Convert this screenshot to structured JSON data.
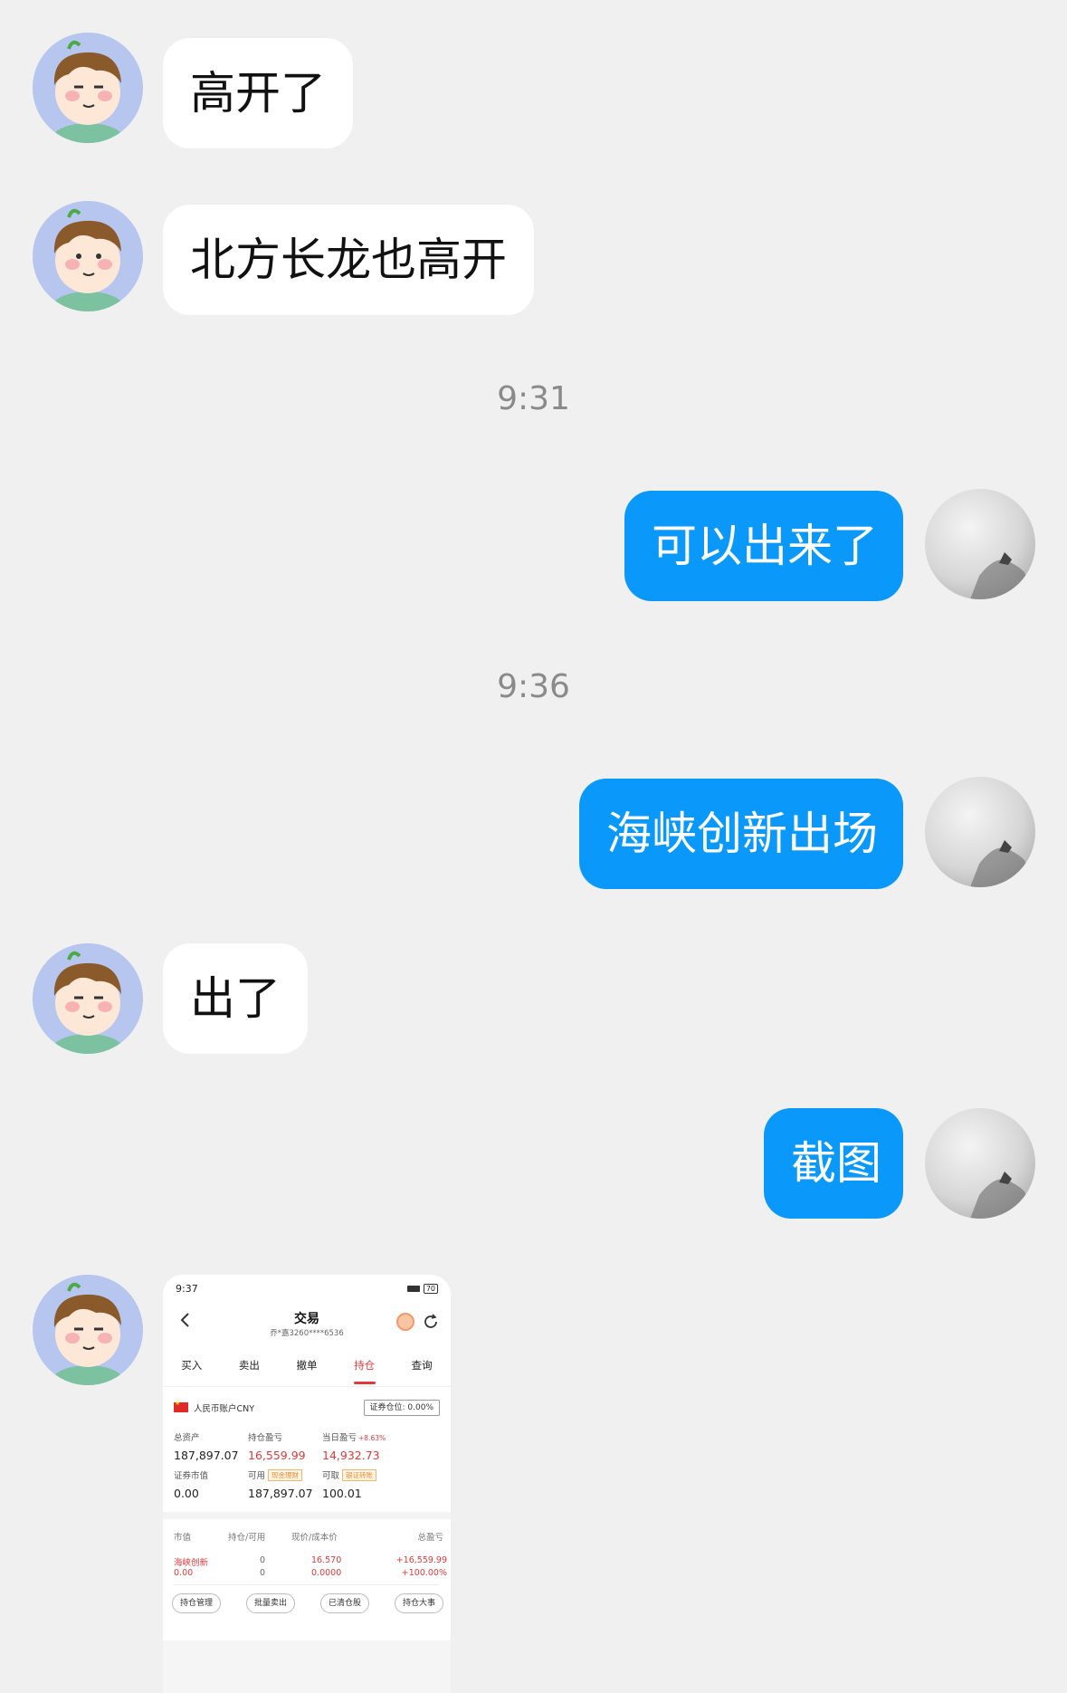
{
  "messages": [
    {
      "text": "高开了"
    },
    {
      "text": "北方长龙也高开"
    },
    {
      "time": "9:31"
    },
    {
      "text": "可以出来了"
    },
    {
      "time": "9:36"
    },
    {
      "text": "海峡创新出场"
    },
    {
      "text": "出了"
    },
    {
      "text": "截图"
    }
  ],
  "screenshot": {
    "status_time": "9:37",
    "battery": "70",
    "title": "交易",
    "account_sub": "乔*嘉3260****6536",
    "tabs": [
      "买入",
      "卖出",
      "撤单",
      "持仓",
      "查询"
    ],
    "active_tab": "持仓",
    "account_name": "人民币账户CNY",
    "position_ratio": "证券仓位: 0.00%",
    "total_assets_label": "总资产",
    "total_assets": "187,897.07",
    "holding_pl_label": "持仓盈亏",
    "holding_pl": "16,559.99",
    "daily_pl_label": "当日盈亏",
    "daily_pl_pct": "+8.63%",
    "daily_pl": "14,932.73",
    "market_value_label": "证券市值",
    "market_value": "0.00",
    "available_label": "可用",
    "available_tag": "现金理财",
    "available": "187,897.07",
    "withdrawable_label": "可取",
    "withdrawable_tag": "银证转账",
    "withdrawable": "100.01",
    "table_headers": [
      "市值",
      "持仓/可用",
      "现价/成本价",
      "总盈亏"
    ],
    "holding": {
      "name": "海峡创新",
      "market_value": "0.00",
      "position": "0",
      "available": "0",
      "price": "16.570",
      "cost": "0.0000",
      "pl": "+16,559.99",
      "pl_pct": "+100.00%"
    },
    "actions": [
      "持仓管理",
      "批量卖出",
      "已清仓股",
      "持仓大事"
    ]
  },
  "colors": {
    "background": "#f0f0f0",
    "outgoing_bubble": "#0a99fa",
    "incoming_bubble": "#ffffff",
    "profit_red": "#e03a3a"
  },
  "icons": {
    "incoming_avatar": "cartoon-boy-avatar",
    "outgoing_avatar": "ink-landscape-avatar"
  }
}
